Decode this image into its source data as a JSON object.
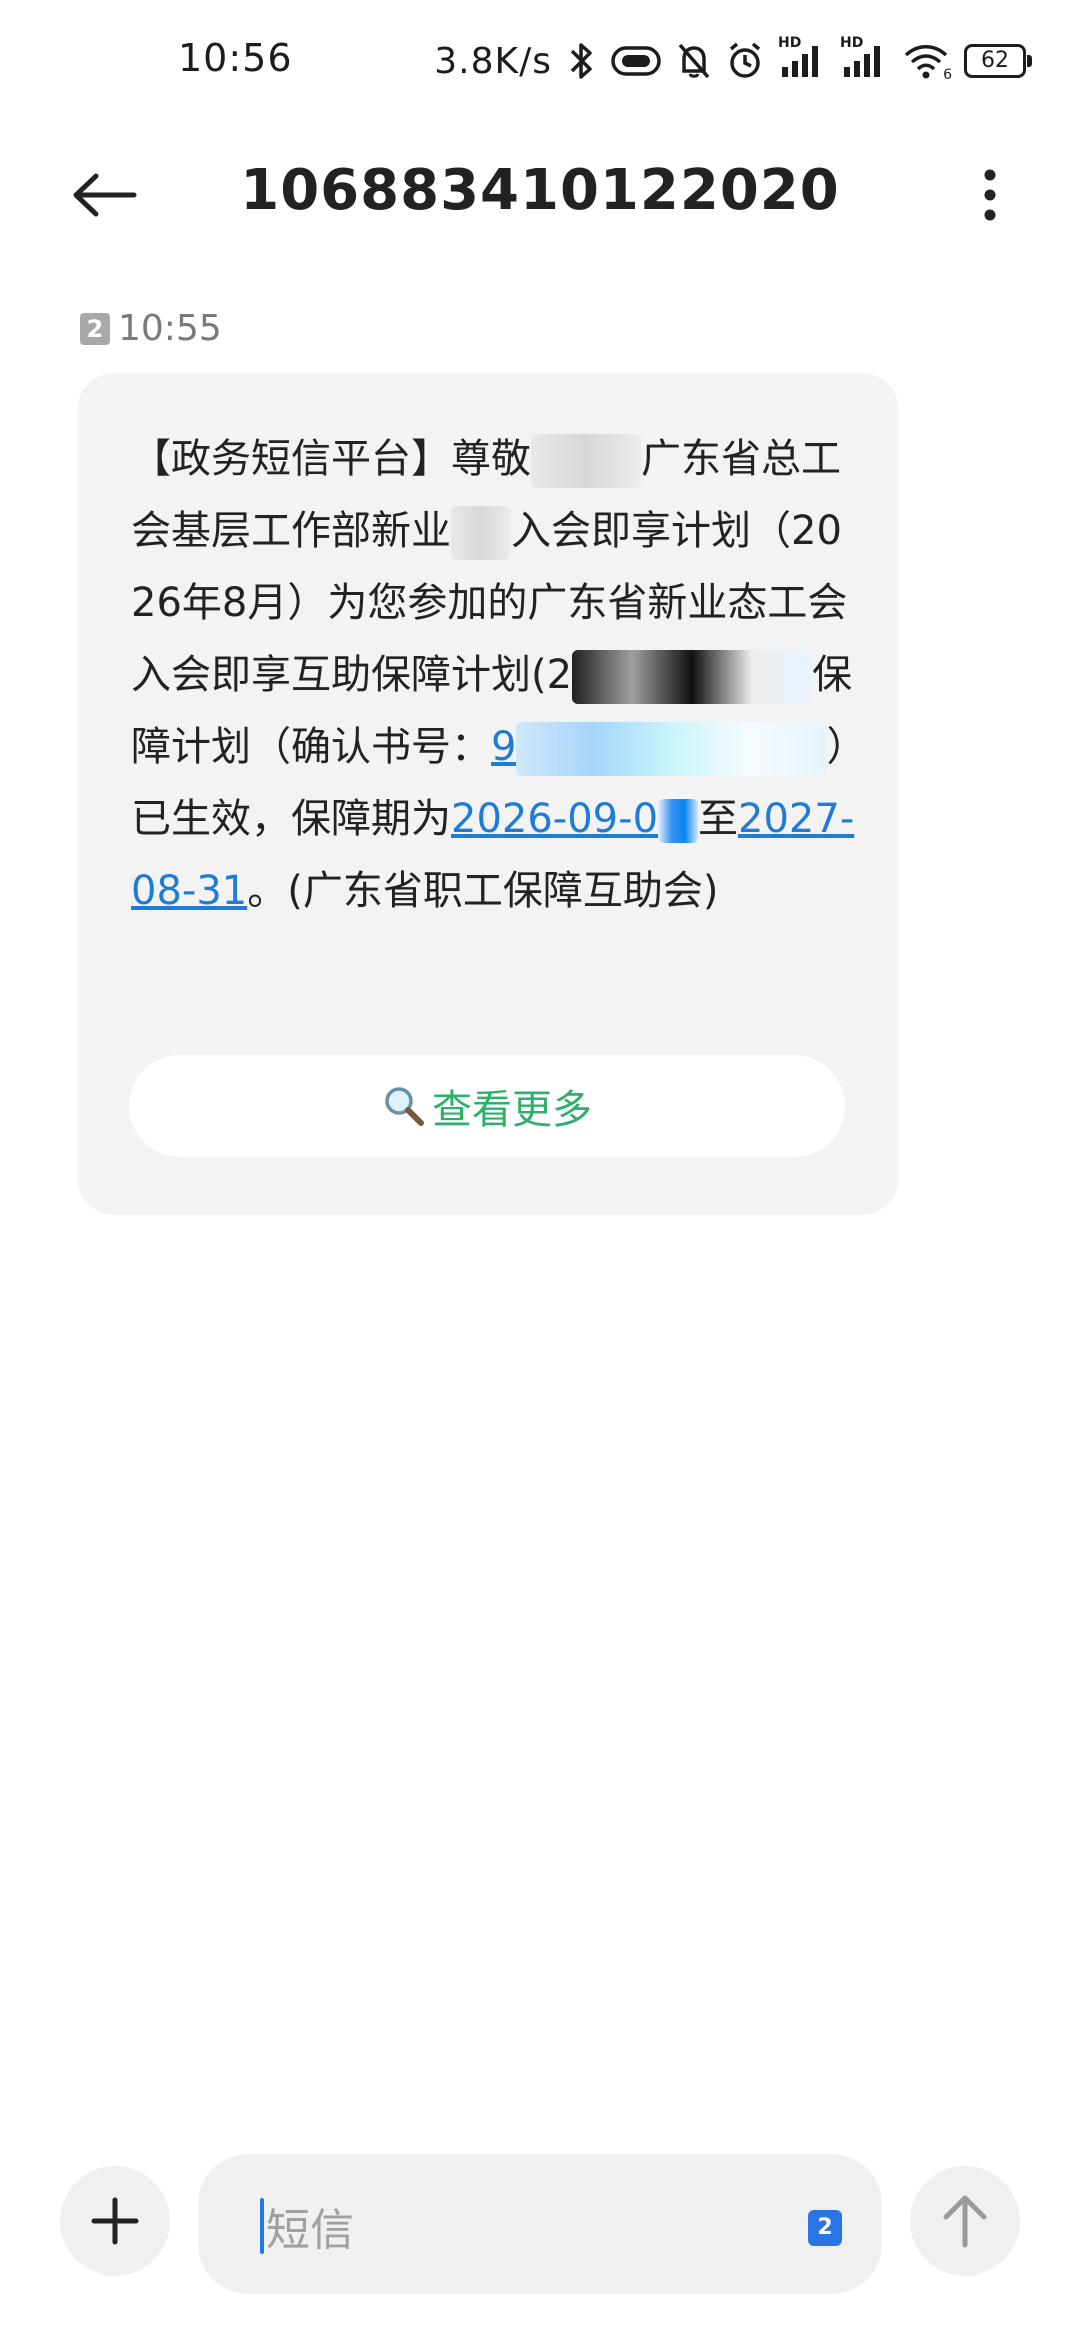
{
  "status_bar": {
    "time": "10:56",
    "net_speed": "3.8K/s",
    "battery": "62",
    "signal_label_1": "HD",
    "signal_label_2": "HD",
    "wifi_label": "6"
  },
  "header": {
    "title": "106883410122020"
  },
  "message": {
    "sim_badge": "2",
    "time": "10:55",
    "text": {
      "p1": "【政务短信平台】尊敬",
      "p2": "广东省总工会基层工作部新业",
      "p3": "入会即享计划（2026年8月）为您参加的广东省新业态工会入会即享互助保障计划",
      "p4": "(2",
      "p5": "保障计划（确认书号：",
      "p6": "9",
      "p7": "）已生效，保障期为",
      "p8": "2026-09-0",
      "p9": "至",
      "p10": "2027-08-31",
      "p11": "。(广东省职工保障互助会)"
    },
    "view_more": "查看更多"
  },
  "composer": {
    "placeholder": "短信",
    "sim_select": "2"
  },
  "colors": {
    "link": "#1f7bd8",
    "view_more": "#2fb06a",
    "bubble": "#f3f3f3",
    "sim_select": "#2b74e6"
  },
  "icons": {
    "back": "back-arrow-icon",
    "more": "more-vertical-icon",
    "search": "magnifier-icon",
    "add": "plus-icon",
    "send": "send-arrow-icon"
  }
}
